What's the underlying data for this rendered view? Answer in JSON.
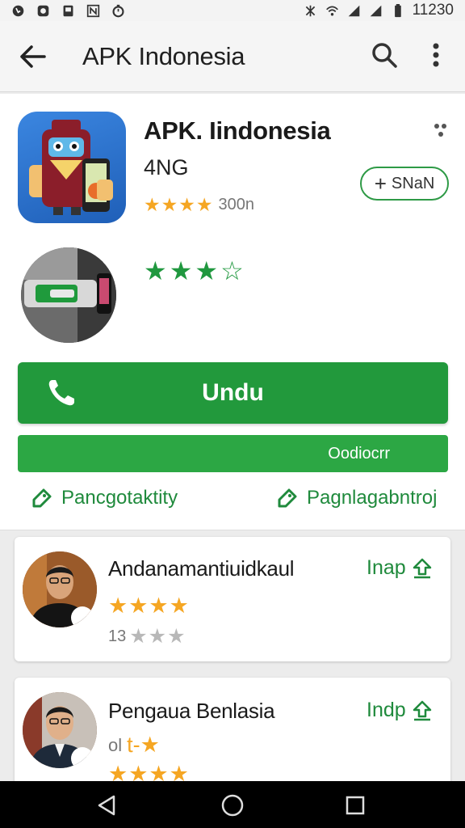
{
  "status_bar": {
    "time": "11230"
  },
  "app_bar": {
    "title": "APK Indonesia"
  },
  "app": {
    "name": "APK. Iindonesia",
    "subtitle": "4NG",
    "rating_stars": "★★★★",
    "rating_count": "300n",
    "share_label": "SNaN"
  },
  "feature": {
    "rating_stars": "★★★☆"
  },
  "buttons": {
    "primary_label": "Undu",
    "secondary_label": "Oodiocrr"
  },
  "links": [
    {
      "label": "Pancgotaktity"
    },
    {
      "label": "Pagnlagabntroj"
    }
  ],
  "reviews": [
    {
      "name": "Andanamantiuidkaul",
      "action": "Inap",
      "stars": "★★★★",
      "count": "13",
      "grey_stars": "★★★"
    },
    {
      "name": "Pengaua Benlasia",
      "action": "Indp",
      "mix_text": "ol",
      "mix_glyph": "t-★",
      "stars": "★★★★"
    }
  ],
  "colors": {
    "primary_green": "#22993c",
    "link_green": "#1f8a3c",
    "star_gold": "#f5a623"
  }
}
